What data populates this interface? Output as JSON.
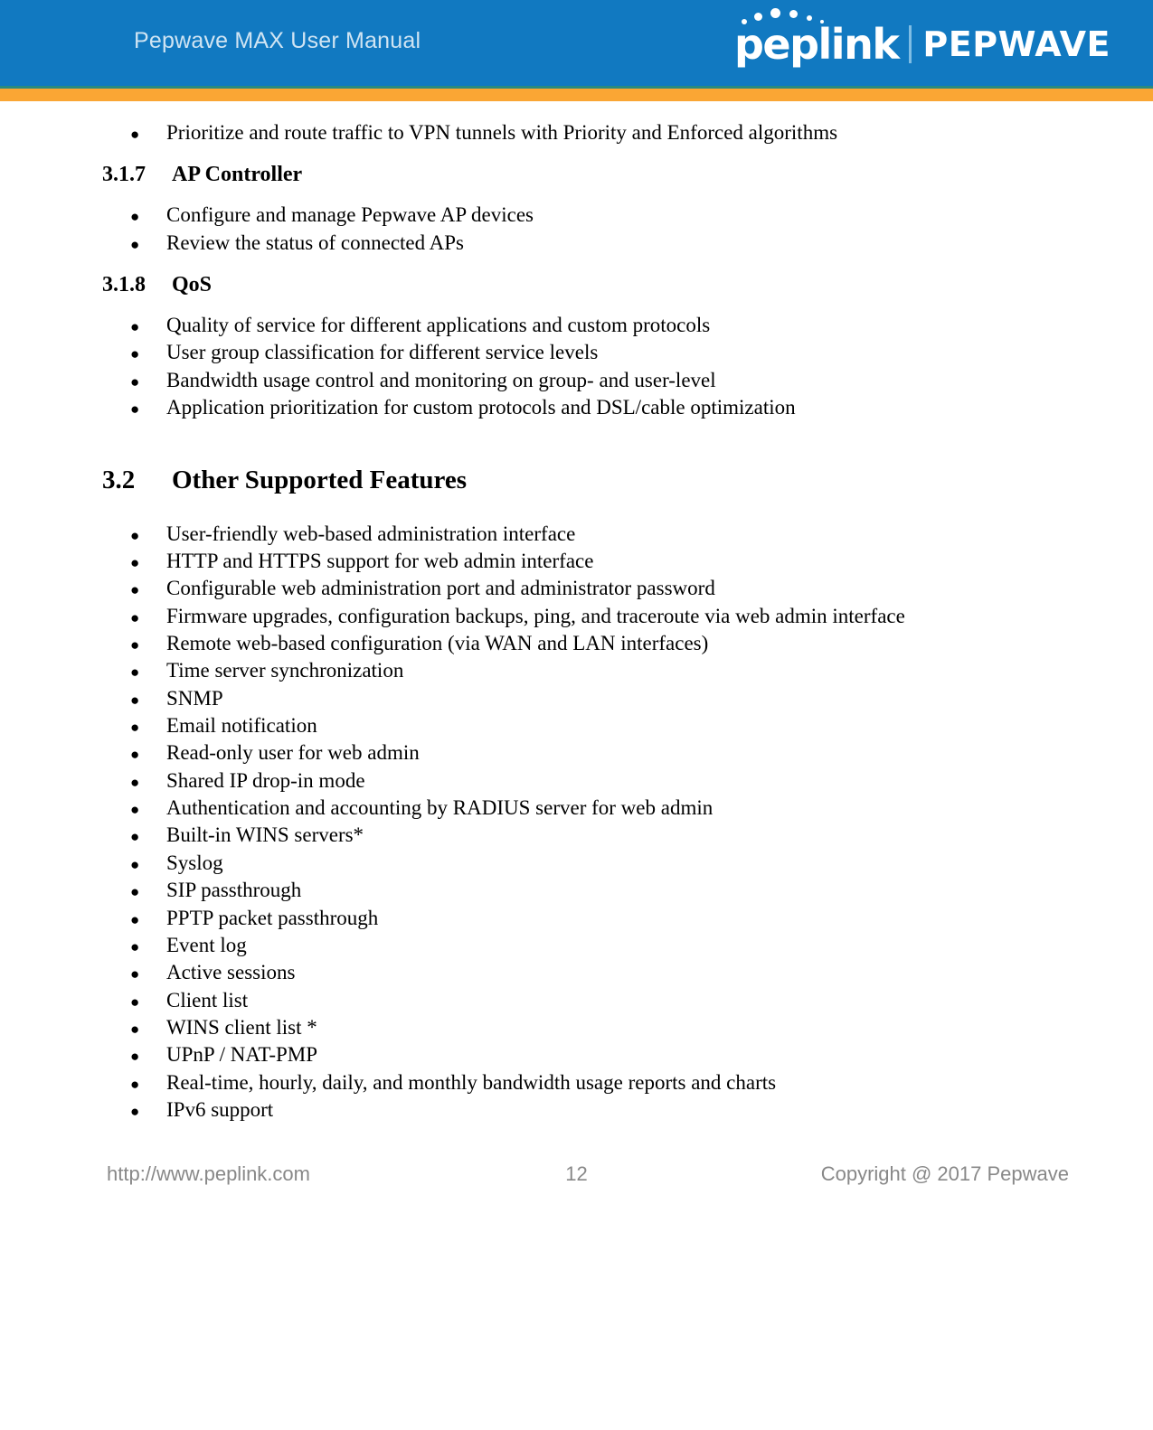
{
  "header": {
    "manual_title": "Pepwave MAX User Manual",
    "logo": {
      "primary": "peplink",
      "secondary": "PEPWAVE"
    },
    "colors": {
      "header_blue": "#1179c1",
      "accent_orange": "#faa634",
      "rule_teal": "#2a8a7e",
      "title_text": "#cfe4f3"
    }
  },
  "body": {
    "bullet_glyph": "●",
    "intro_bullets": [
      "Prioritize and route traffic to VPN tunnels with Priority and Enforced algorithms"
    ],
    "sections": [
      {
        "number": "3.1.7",
        "title": "AP Controller",
        "level": 3,
        "bullets": [
          "Configure and manage Pepwave AP devices",
          "Review the status of connected APs"
        ]
      },
      {
        "number": "3.1.8",
        "title": "QoS",
        "level": 3,
        "bullets": [
          "Quality of service for different applications and custom protocols",
          "User group classification for different service levels",
          "Bandwidth usage control and monitoring on group- and user-level",
          "Application prioritization for custom protocols and DSL/cable optimization"
        ]
      },
      {
        "number": "3.2",
        "title": "Other Supported Features",
        "level": 2,
        "bullets": [
          "User-friendly web-based administration interface",
          "HTTP and HTTPS support for web admin interface",
          "Configurable web administration port and administrator password",
          "Firmware upgrades, configuration backups, ping, and traceroute via web admin interface",
          "Remote web-based configuration (via WAN and LAN interfaces)",
          "Time server synchronization",
          "SNMP",
          "Email notification",
          "Read-only user for web admin",
          "Shared IP drop-in mode",
          "Authentication and accounting by RADIUS server for web admin",
          "Built-in WINS servers*",
          "Syslog",
          "SIP passthrough",
          "PPTP packet passthrough",
          "Event log",
          "Active sessions",
          "Client list",
          "WINS client list *",
          "UPnP / NAT-PMP",
          "Real-time, hourly, daily, and monthly bandwidth usage reports and charts",
          "IPv6 support"
        ]
      }
    ]
  },
  "footer": {
    "url": "http://www.peplink.com",
    "page_number": "12",
    "copyright": "Copyright @ 2017 Pepwave"
  }
}
